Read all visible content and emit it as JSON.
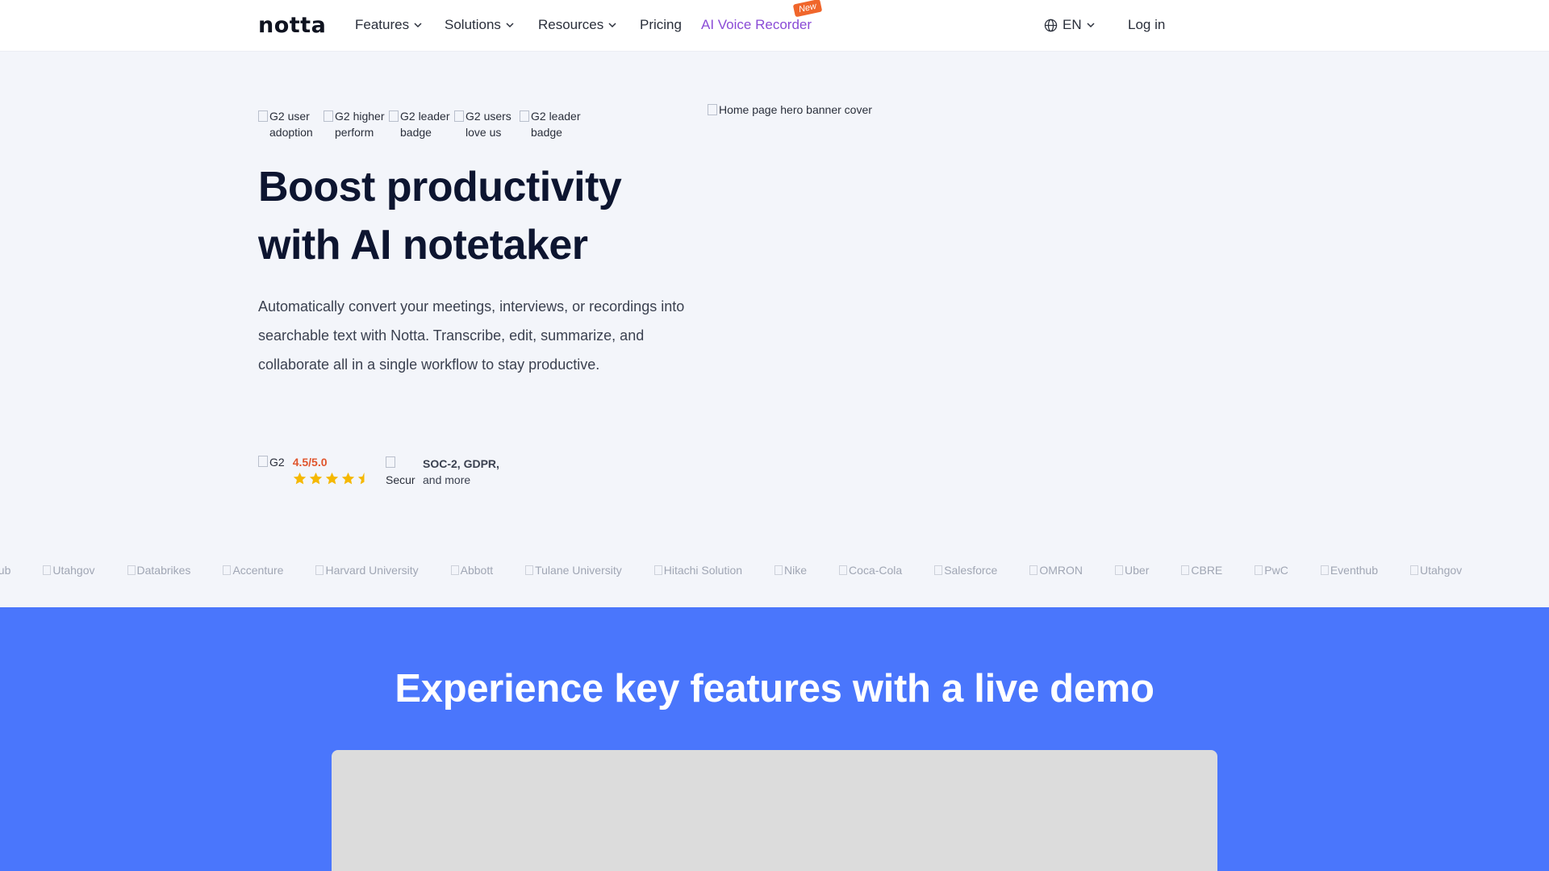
{
  "nav": {
    "logo": "notta",
    "features": "Features",
    "solutions": "Solutions",
    "resources": "Resources",
    "pricing": "Pricing",
    "voice_recorder": "AI Voice Recorder",
    "new_badge": "New",
    "language": "EN",
    "login": "Log in"
  },
  "hero": {
    "badges": [
      "G2 user adoption",
      "G2 higher perform",
      "G2 leader badge",
      "G2 users love us",
      "G2 leader badge"
    ],
    "title": "Boost productivity with AI notetaker",
    "description": "Automatically convert your meetings, interviews, or recordings into searchable text with Notta. Transcribe, edit, summarize, and collaborate all in a single workflow to stay productive.",
    "banner_alt": "Home page hero banner cover",
    "g2_alt": "G2",
    "rating": "4.5/5.0",
    "security_alt": "Secur",
    "security_bold": "SOC-2, GDPR,",
    "security_more": "and more"
  },
  "logos": [
    "hub",
    "Utahgov",
    "Databrikes",
    "Accenture",
    "Harvard University",
    "Abbott",
    "Tulane University",
    "Hitachi Solution",
    "Nike",
    "Coca-Cola",
    "Salesforce",
    "OMRON",
    "Uber",
    "CBRE",
    "PwC",
    "Eventhub",
    "Utahgov"
  ],
  "demo": {
    "title": "Experience key features with a live demo"
  },
  "colors": {
    "accent_blue": "#4a76fc",
    "voice_purple": "#8a4bd6",
    "rating_orange": "#e0552d",
    "star_yellow": "#f5b800"
  }
}
